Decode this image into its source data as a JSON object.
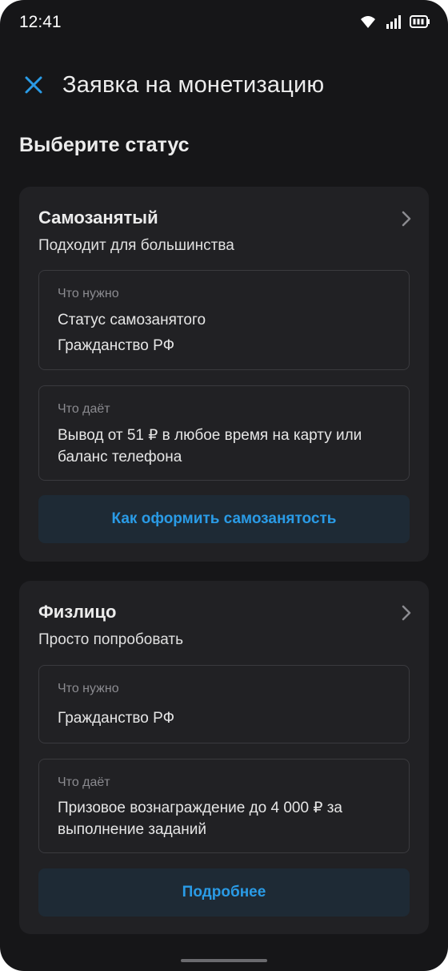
{
  "status_bar": {
    "time": "12:41",
    "icons": [
      "wifi-icon",
      "signal-icon",
      "battery-icon"
    ]
  },
  "header": {
    "close_icon": "close-icon",
    "title": "Заявка на монетизацию"
  },
  "section_title": "Выберите статус",
  "cards": [
    {
      "title": "Самозанятый",
      "subtitle": "Подходит для большинства",
      "need": {
        "label": "Что нужно",
        "lines": [
          "Статус самозанятого",
          "Гражданство РФ"
        ]
      },
      "gives": {
        "label": "Что даёт",
        "text": "Вывод от 51 ₽ в любое время на карту или баланс телефона"
      },
      "button": "Как оформить самозанятость"
    },
    {
      "title": "Физлицо",
      "subtitle": "Просто попробовать",
      "need": {
        "label": "Что нужно",
        "lines": [
          "Гражданство РФ"
        ]
      },
      "gives": {
        "label": "Что даёт",
        "text": "Призовое вознаграждение до 4 000 ₽ за выполнение заданий"
      },
      "button": "Подробнее"
    }
  ],
  "colors": {
    "background": "#161618",
    "card": "#212124",
    "accent": "#2a9be6",
    "button_bg": "#1e2a35"
  }
}
